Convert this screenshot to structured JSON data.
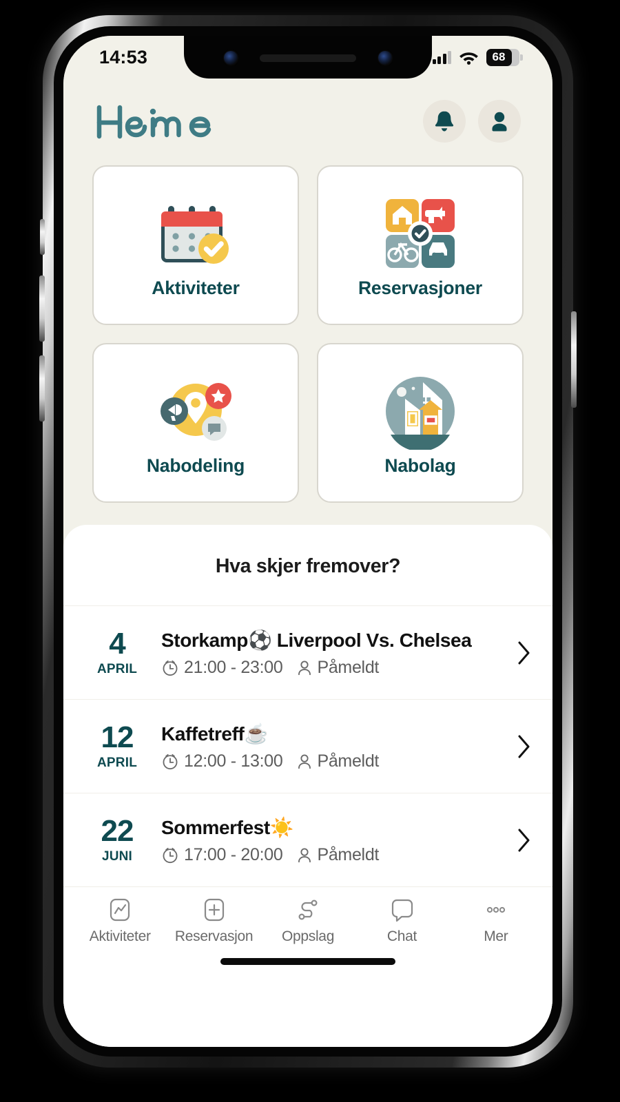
{
  "status_bar": {
    "time": "14:53",
    "battery_level": "68",
    "signal_icon": "cellular-signal-icon",
    "wifi_icon": "wifi-icon",
    "battery_icon": "battery-icon"
  },
  "header": {
    "logo_text": "Heime",
    "notifications_icon": "bell-icon",
    "profile_icon": "person-icon"
  },
  "tiles": [
    {
      "label": "Aktiviteter",
      "icon": "calendar-check-icon"
    },
    {
      "label": "Reservasjoner",
      "icon": "booking-grid-icon"
    },
    {
      "label": "Nabodeling",
      "icon": "location-share-icon"
    },
    {
      "label": "Nabolag",
      "icon": "neighborhood-houses-icon"
    }
  ],
  "upcoming": {
    "title": "Hva skjer fremover?",
    "events": [
      {
        "day": "4",
        "month": "APRIL",
        "title": "Storkamp⚽ Liverpool Vs. Chelsea",
        "time": "21:00 - 23:00",
        "attendance": "Påmeldt",
        "clock_icon": "clock-icon",
        "person_icon": "person-icon",
        "chevron_icon": "chevron-right-icon"
      },
      {
        "day": "12",
        "month": "APRIL",
        "title": "Kaffetreff☕",
        "time": "12:00 - 13:00",
        "attendance": "Påmeldt",
        "clock_icon": "clock-icon",
        "person_icon": "person-icon",
        "chevron_icon": "chevron-right-icon"
      },
      {
        "day": "22",
        "month": "JUNI",
        "title": "Sommerfest☀️",
        "time": "17:00 - 20:00",
        "attendance": "Påmeldt",
        "clock_icon": "clock-icon",
        "person_icon": "person-icon",
        "chevron_icon": "chevron-right-icon"
      }
    ]
  },
  "bottom_nav": [
    {
      "label": "Aktiviteter",
      "icon": "activity-chart-icon"
    },
    {
      "label": "Reservasjon",
      "icon": "plus-square-icon"
    },
    {
      "label": "Oppslag",
      "icon": "route-icon"
    },
    {
      "label": "Chat",
      "icon": "chat-bubble-icon"
    },
    {
      "label": "Mer",
      "icon": "more-dots-icon"
    }
  ],
  "colors": {
    "brand_teal": "#0E4A50",
    "logo_teal": "#3F7C85",
    "app_background": "#F2F1E9",
    "card_white": "#FFFFFF",
    "card_border": "#D8D6CE",
    "accent_yellow": "#F5C košice"
  }
}
